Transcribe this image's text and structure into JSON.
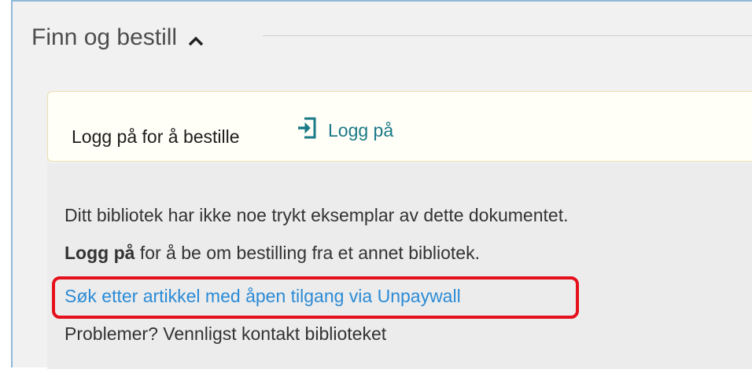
{
  "section": {
    "title": "Finn og bestill",
    "chevron_icon": "chevron-up-icon"
  },
  "login_box": {
    "prompt": "Logg på for å bestille",
    "link_icon": "sign-in-icon",
    "link_label": "Logg på"
  },
  "info": {
    "line1": "Ditt bibliotek har ikke noe trykt eksemplar av dette dokumentet.",
    "line2_bold": "Logg på",
    "line2_rest": " for å be om bestilling fra et annet bibliotek.",
    "unpaywall_link": "Søk etter artikkel med åpen tilgang via Unpaywall",
    "problems": "Problemer? Vennligst kontakt biblioteket"
  },
  "colors": {
    "accent_teal": "#1b7a87",
    "link_blue": "#2b8bd6",
    "highlight_red": "#e5101c",
    "frame_border": "#8fb9d8"
  }
}
